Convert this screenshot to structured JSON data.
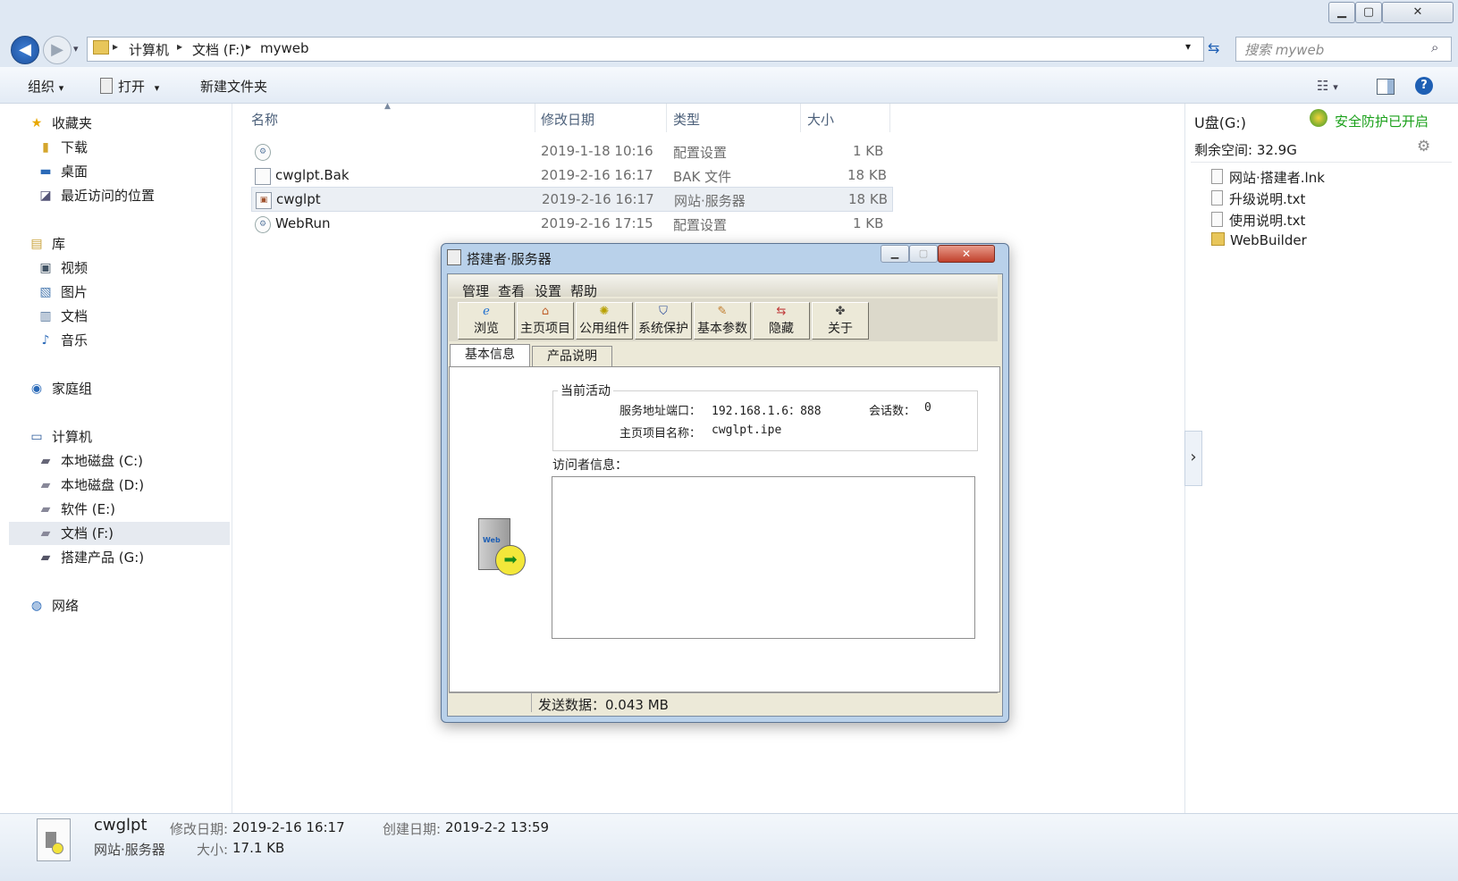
{
  "window": {
    "minimize_glyph": "▁",
    "restore_glyph": "▢",
    "close_glyph": "✕"
  },
  "address": {
    "back_glyph": "◀",
    "forward_glyph": "▶",
    "crumb_sep": "▸",
    "crumbs": [
      "计算机",
      "文档 (F:)",
      "myweb"
    ],
    "search_placeholder": "搜索 myweb"
  },
  "toolbar": {
    "organize": "组织",
    "open": "打开",
    "new_folder": "新建文件夹",
    "dropdown_glyph": "▾",
    "help_glyph": "?"
  },
  "nav": {
    "favorites": "收藏夹",
    "downloads": "下载",
    "desktop": "桌面",
    "recent": "最近访问的位置",
    "libraries": "库",
    "videos": "视频",
    "pictures": "图片",
    "documents": "文档",
    "music": "音乐",
    "homegroup": "家庭组",
    "computer": "计算机",
    "drive_c": "本地磁盘 (C:)",
    "drive_d": "本地磁盘 (D:)",
    "drive_e": "软件 (E:)",
    "drive_f": "文档 (F:)",
    "drive_g": "搭建产品 (G:)",
    "network": "网络"
  },
  "columns": {
    "name": "名称",
    "modified": "修改日期",
    "type": "类型",
    "size": "大小"
  },
  "files": [
    {
      "name": "",
      "modified": "2019-1-18 10:16",
      "type": "配置设置",
      "size": "1 KB"
    },
    {
      "name": "cwglpt.Bak",
      "modified": "2019-2-16 16:17",
      "type": "BAK 文件",
      "size": "18 KB"
    },
    {
      "name": "cwglpt",
      "modified": "2019-2-16 16:17",
      "type": "网站·服务器",
      "size": "18 KB"
    },
    {
      "name": "WebRun",
      "modified": "2019-2-16 17:15",
      "type": "配置设置",
      "size": "1 KB"
    }
  ],
  "preview": {
    "drive": "U盘(G:)",
    "protect": "安全防护已开启",
    "free_space": "剩余空间: 32.9G",
    "items": [
      "网站·搭建者.lnk",
      "升级说明.txt",
      "使用说明.txt",
      "WebBuilder"
    ],
    "expand_glyph": "›"
  },
  "details": {
    "name": "cwglpt",
    "type": "网站·服务器",
    "modified_label": "修改日期:",
    "modified": "2019-2-16 16:17",
    "created_label": "创建日期:",
    "created": "2019-2-2 13:59",
    "size_label": "大小:",
    "size": "17.1 KB"
  },
  "dialog": {
    "title": "搭建者·服务器",
    "menu": [
      "管理",
      "查看",
      "设置",
      "帮助"
    ],
    "tools": [
      "浏览",
      "主页项目",
      "公用组件",
      "系统保护",
      "基本参数",
      "隐藏",
      "关于"
    ],
    "tabs": [
      "基本信息",
      "产品说明"
    ],
    "group_label": "当前活动",
    "server_addr_label": "服务地址端口：",
    "server_addr": "192.168.1.6：888",
    "sessions_label": "会话数：",
    "sessions": "0",
    "project_label": "主页项目名称：",
    "project": "cwglpt.ipe",
    "visitor_label": "访问者信息：",
    "status": "发送数据：0.043 MB",
    "web_label": "Web"
  },
  "colors": {
    "accent": "#1e5fb4",
    "protect_green": "#1aa01a"
  }
}
